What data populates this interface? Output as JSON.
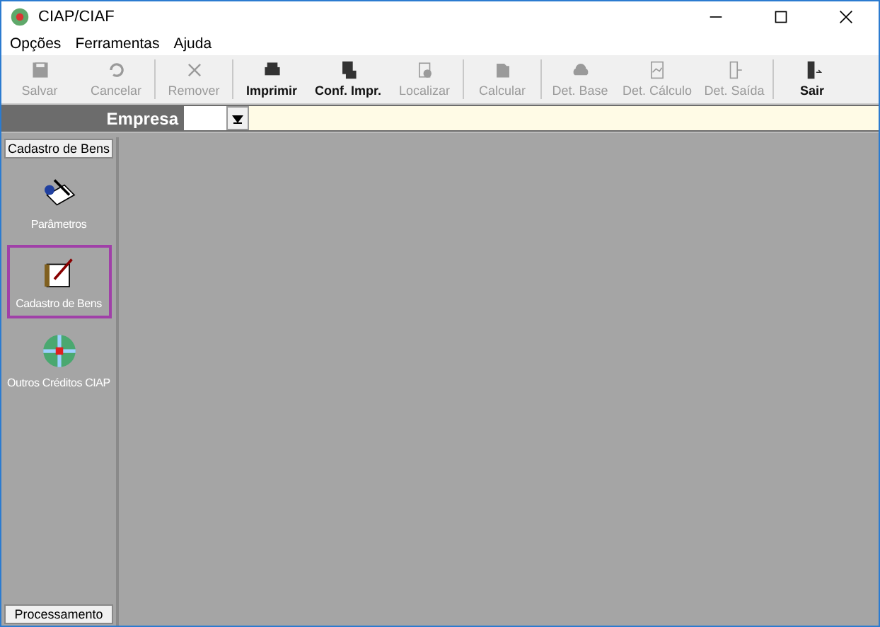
{
  "window": {
    "title": "CIAP/CIAF"
  },
  "menu": [
    "Opções",
    "Ferramentas",
    "Ajuda"
  ],
  "toolbar": [
    {
      "buttons": [
        {
          "label": "Salvar",
          "kind": "save",
          "disabled": true
        },
        {
          "label": "Cancelar",
          "kind": "undo",
          "disabled": true
        }
      ]
    },
    {
      "buttons": [
        {
          "label": "Remover",
          "kind": "remove",
          "disabled": true
        }
      ]
    },
    {
      "buttons": [
        {
          "label": "Imprimir",
          "kind": "print",
          "disabled": false
        },
        {
          "label": "Conf. Impr.",
          "kind": "printsetup",
          "disabled": false
        },
        {
          "label": "Localizar",
          "kind": "find",
          "disabled": true
        }
      ]
    },
    {
      "buttons": [
        {
          "label": "Calcular",
          "kind": "calc",
          "disabled": true
        }
      ]
    },
    {
      "buttons": [
        {
          "label": "Det. Base",
          "kind": "base",
          "disabled": true
        },
        {
          "label": "Det. Cálculo",
          "kind": "sheet",
          "disabled": true
        },
        {
          "label": "Det. Saída",
          "kind": "out",
          "disabled": true
        }
      ]
    },
    {
      "buttons": [
        {
          "label": "Sair",
          "kind": "exit",
          "disabled": false
        }
      ]
    }
  ],
  "empresa": {
    "label": "Empresa"
  },
  "sidebar": {
    "header": "Cadastro de Bens",
    "items": [
      {
        "label": "Parâmetros",
        "kind": "params",
        "selected": false
      },
      {
        "label": "Cadastro de Bens",
        "kind": "assets",
        "selected": true
      },
      {
        "label": "Outros Créditos CIAP",
        "kind": "credits",
        "selected": false
      }
    ],
    "footer": "Processamento"
  }
}
